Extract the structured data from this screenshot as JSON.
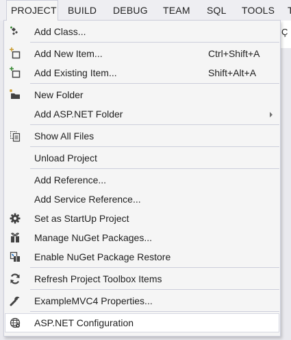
{
  "menubar": {
    "items": [
      {
        "label": "PROJECT"
      },
      {
        "label": "BUILD"
      },
      {
        "label": "DEBUG"
      },
      {
        "label": "TEAM"
      },
      {
        "label": "SQL"
      },
      {
        "label": "TOOLS"
      },
      {
        "label": "T"
      }
    ]
  },
  "background": {
    "fragment": "Ç"
  },
  "menu": {
    "items": [
      {
        "label": "Add Class...",
        "icon": "add-class-icon"
      },
      {
        "label": "Add New Item...",
        "shortcut": "Ctrl+Shift+A",
        "icon": "add-new-item-icon"
      },
      {
        "label": "Add Existing Item...",
        "shortcut": "Shift+Alt+A",
        "icon": "add-existing-item-icon"
      },
      {
        "label": "New Folder",
        "icon": "new-folder-icon"
      },
      {
        "label": "Add ASP.NET Folder",
        "has_submenu": true
      },
      {
        "label": "Show All Files",
        "icon": "show-all-files-icon"
      },
      {
        "label": "Unload Project"
      },
      {
        "label": "Add Reference..."
      },
      {
        "label": "Add Service Reference..."
      },
      {
        "label": "Set as StartUp Project",
        "icon": "gear-icon"
      },
      {
        "label": "Manage NuGet Packages...",
        "icon": "nuget-package-icon"
      },
      {
        "label": "Enable NuGet Package Restore",
        "icon": "package-restore-icon"
      },
      {
        "label": "Refresh Project Toolbox Items",
        "icon": "refresh-icon"
      },
      {
        "label": "ExampleMVC4 Properties...",
        "icon": "wrench-icon"
      },
      {
        "label": "ASP.NET Configuration",
        "icon": "globe-config-icon",
        "highlighted": true
      }
    ]
  },
  "colors": {
    "menu_background": "#f5f5f5",
    "hover_background": "#ffffff",
    "border": "#cccedb",
    "text": "#1e1e1e",
    "icon": "#424242"
  }
}
